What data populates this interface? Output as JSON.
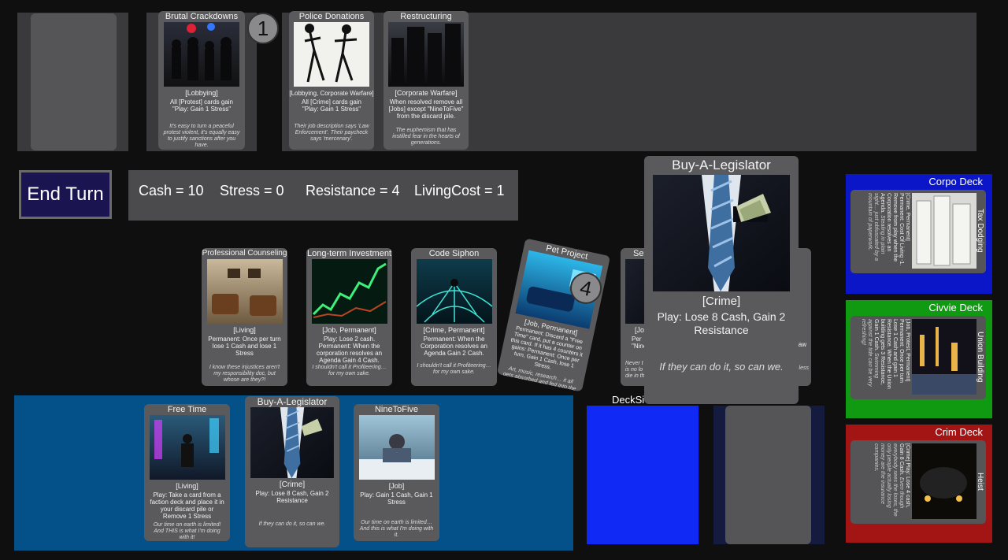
{
  "end_turn_label": "End Turn",
  "stats": {
    "cash": "Cash = 10",
    "stress": "Stress = 0",
    "resistance": "Resistance = 4",
    "living_cost": "LivingCost = 1"
  },
  "agenda": {
    "badge": "1",
    "cards": [
      {
        "title": "Brutal Crackdowns",
        "tags": "[Lobbying]",
        "effect": "All [Protest] cards gain \"Play: Gain 1 Stress\"",
        "flavor": "It's easy to turn a peaceful protest violent, it's equally easy to justify sanctions after you have."
      },
      {
        "title": "Police Donations",
        "tags": "[Lobbying, Corporate Warfare]",
        "effect": "All [Crime] cards gain \"Play: Gain 1 Stress\"",
        "flavor": "Their job description says 'Law Enforcement'. Their paycheck says 'mercenary'."
      },
      {
        "title": "Restructuring",
        "tags": "[Corporate Warfare]",
        "effect": "When resolved remove all [Jobs] except \"NineToFive\" from the discard pile.",
        "flavor": "The euphemism that has instilled fear in the hearts of generations."
      }
    ]
  },
  "board": {
    "cards": [
      {
        "title": "Professional Counseling",
        "tags": "[Living]",
        "effect": "Permanent: Once per turn lose 1 Cash and lose 1 Stress",
        "flavor": "I know these injustices aren't my responsibility doc, but whose are they?!"
      },
      {
        "title": "Long-term Investment",
        "tags": "[Job, Permanent]",
        "effect": "Play: Lose 2 cash. Permanent: When the corporation resolves an Agenda Gain 4 Cash.",
        "flavor": "I shouldn't call it Profiteering… for my own sake."
      },
      {
        "title": "Code Siphon",
        "tags": "[Crime, Permanent]",
        "effect": "Permanent: When the Corporation resolves an Agenda Gain 2 Cash.",
        "flavor": "I shouldn't call it Profiteering… for my own sake."
      },
      {
        "title": "Pet Project",
        "badge": "4",
        "tags": "[Job, Permanent]",
        "effect": "Permanent: Discard a \"Free Time\" card, put a counter on this card. If it has 4 counters it gains: Permanent: Once per turn, Gain 1 Cash, lose 1 Stress.",
        "flavor": "Art, music, research… it all gets absorbed and fed into the system one way or another."
      }
    ],
    "partial": {
      "title": "Se",
      "tags": "[Jo",
      "effect": "Per\n\"Nine",
      "flavor": "Never t\nis no lo\ndie in th"
    },
    "right_edge": {
      "effect": "aw",
      "flavor": "less"
    }
  },
  "hover_card": {
    "title": "Buy-A-Legislator",
    "tags": "[Crime]",
    "effect": "Play: Lose 8 Cash, Gain 2 Resistance",
    "flavor": "If they can do it, so can we."
  },
  "hand": {
    "cards": [
      {
        "title": "Free Time",
        "tags": "[Living]",
        "effect": "Play: Take a card from a faction deck and place it in your discard pile or Remove 1 Stress",
        "flavor": "Our time on earth is limited! And THIS is what I'm doing with it!"
      },
      {
        "title": "Buy-A-Legislator",
        "tags": "[Crime]",
        "effect": "Play: Lose 8 Cash, Gain 2 Resistance",
        "flavor": "If they can do it, so can we."
      },
      {
        "title": "NineToFive",
        "tags": "[Job]",
        "effect": "Play: Gain 1 Cash, Gain 1 Stress",
        "flavor": "Our time on earth is limited… And this is what I'm doing with it."
      }
    ]
  },
  "decksize_label": "DeckSi",
  "decks": [
    {
      "name": "Corpo Deck",
      "color": "#0a16c8",
      "card_title": "Tax Dodging",
      "card_text": "[Crime, Permanent] Permanent: Cost Of Living -1. Remove from play when the Corporation resolves an Agenda.",
      "card_flavor": "Stealing in plain sight… just obfuscated by a mountain of paperwork."
    },
    {
      "name": "Civvie Deck",
      "color": "#0f9a12",
      "card_title": "Union Building",
      "card_text": "[Job, Protest, Permanent] Permanent: Once per turn Lose 1 Cash and gain 1 Resistance. When the Union building gets 3 Resistance, Gain 1 Cash.",
      "card_flavor": "Swimming against the tide can be very refreshing!"
    },
    {
      "name": "Crim Deck",
      "color": "#a31414",
      "card_title": "Heist",
      "card_text": "[Crime] Play: Lose 4 cash, Gain 8 Cash.",
      "card_flavor": "Even though everybody sees the loses, the only people actually losing money are the insurance companies."
    }
  ],
  "colors": {
    "hand_area": "#045089",
    "deck_pile": "#1129f5",
    "discard_area": "#141b3e",
    "end_turn_bg": "#1a1450"
  }
}
